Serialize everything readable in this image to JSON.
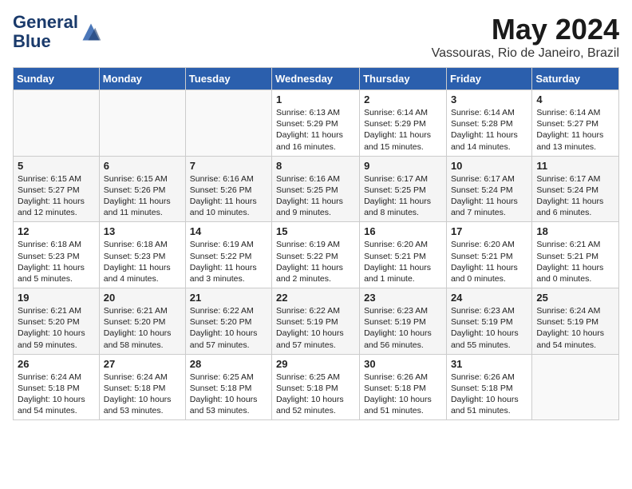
{
  "header": {
    "logo_line1": "General",
    "logo_line2": "Blue",
    "month": "May 2024",
    "location": "Vassouras, Rio de Janeiro, Brazil"
  },
  "weekdays": [
    "Sunday",
    "Monday",
    "Tuesday",
    "Wednesday",
    "Thursday",
    "Friday",
    "Saturday"
  ],
  "weeks": [
    [
      {
        "day": "",
        "info": ""
      },
      {
        "day": "",
        "info": ""
      },
      {
        "day": "",
        "info": ""
      },
      {
        "day": "1",
        "info": "Sunrise: 6:13 AM\nSunset: 5:29 PM\nDaylight: 11 hours\nand 16 minutes."
      },
      {
        "day": "2",
        "info": "Sunrise: 6:14 AM\nSunset: 5:29 PM\nDaylight: 11 hours\nand 15 minutes."
      },
      {
        "day": "3",
        "info": "Sunrise: 6:14 AM\nSunset: 5:28 PM\nDaylight: 11 hours\nand 14 minutes."
      },
      {
        "day": "4",
        "info": "Sunrise: 6:14 AM\nSunset: 5:27 PM\nDaylight: 11 hours\nand 13 minutes."
      }
    ],
    [
      {
        "day": "5",
        "info": "Sunrise: 6:15 AM\nSunset: 5:27 PM\nDaylight: 11 hours\nand 12 minutes."
      },
      {
        "day": "6",
        "info": "Sunrise: 6:15 AM\nSunset: 5:26 PM\nDaylight: 11 hours\nand 11 minutes."
      },
      {
        "day": "7",
        "info": "Sunrise: 6:16 AM\nSunset: 5:26 PM\nDaylight: 11 hours\nand 10 minutes."
      },
      {
        "day": "8",
        "info": "Sunrise: 6:16 AM\nSunset: 5:25 PM\nDaylight: 11 hours\nand 9 minutes."
      },
      {
        "day": "9",
        "info": "Sunrise: 6:17 AM\nSunset: 5:25 PM\nDaylight: 11 hours\nand 8 minutes."
      },
      {
        "day": "10",
        "info": "Sunrise: 6:17 AM\nSunset: 5:24 PM\nDaylight: 11 hours\nand 7 minutes."
      },
      {
        "day": "11",
        "info": "Sunrise: 6:17 AM\nSunset: 5:24 PM\nDaylight: 11 hours\nand 6 minutes."
      }
    ],
    [
      {
        "day": "12",
        "info": "Sunrise: 6:18 AM\nSunset: 5:23 PM\nDaylight: 11 hours\nand 5 minutes."
      },
      {
        "day": "13",
        "info": "Sunrise: 6:18 AM\nSunset: 5:23 PM\nDaylight: 11 hours\nand 4 minutes."
      },
      {
        "day": "14",
        "info": "Sunrise: 6:19 AM\nSunset: 5:22 PM\nDaylight: 11 hours\nand 3 minutes."
      },
      {
        "day": "15",
        "info": "Sunrise: 6:19 AM\nSunset: 5:22 PM\nDaylight: 11 hours\nand 2 minutes."
      },
      {
        "day": "16",
        "info": "Sunrise: 6:20 AM\nSunset: 5:21 PM\nDaylight: 11 hours\nand 1 minute."
      },
      {
        "day": "17",
        "info": "Sunrise: 6:20 AM\nSunset: 5:21 PM\nDaylight: 11 hours\nand 0 minutes."
      },
      {
        "day": "18",
        "info": "Sunrise: 6:21 AM\nSunset: 5:21 PM\nDaylight: 11 hours\nand 0 minutes."
      }
    ],
    [
      {
        "day": "19",
        "info": "Sunrise: 6:21 AM\nSunset: 5:20 PM\nDaylight: 10 hours\nand 59 minutes."
      },
      {
        "day": "20",
        "info": "Sunrise: 6:21 AM\nSunset: 5:20 PM\nDaylight: 10 hours\nand 58 minutes."
      },
      {
        "day": "21",
        "info": "Sunrise: 6:22 AM\nSunset: 5:20 PM\nDaylight: 10 hours\nand 57 minutes."
      },
      {
        "day": "22",
        "info": "Sunrise: 6:22 AM\nSunset: 5:19 PM\nDaylight: 10 hours\nand 57 minutes."
      },
      {
        "day": "23",
        "info": "Sunrise: 6:23 AM\nSunset: 5:19 PM\nDaylight: 10 hours\nand 56 minutes."
      },
      {
        "day": "24",
        "info": "Sunrise: 6:23 AM\nSunset: 5:19 PM\nDaylight: 10 hours\nand 55 minutes."
      },
      {
        "day": "25",
        "info": "Sunrise: 6:24 AM\nSunset: 5:19 PM\nDaylight: 10 hours\nand 54 minutes."
      }
    ],
    [
      {
        "day": "26",
        "info": "Sunrise: 6:24 AM\nSunset: 5:18 PM\nDaylight: 10 hours\nand 54 minutes."
      },
      {
        "day": "27",
        "info": "Sunrise: 6:24 AM\nSunset: 5:18 PM\nDaylight: 10 hours\nand 53 minutes."
      },
      {
        "day": "28",
        "info": "Sunrise: 6:25 AM\nSunset: 5:18 PM\nDaylight: 10 hours\nand 53 minutes."
      },
      {
        "day": "29",
        "info": "Sunrise: 6:25 AM\nSunset: 5:18 PM\nDaylight: 10 hours\nand 52 minutes."
      },
      {
        "day": "30",
        "info": "Sunrise: 6:26 AM\nSunset: 5:18 PM\nDaylight: 10 hours\nand 51 minutes."
      },
      {
        "day": "31",
        "info": "Sunrise: 6:26 AM\nSunset: 5:18 PM\nDaylight: 10 hours\nand 51 minutes."
      },
      {
        "day": "",
        "info": ""
      }
    ]
  ]
}
